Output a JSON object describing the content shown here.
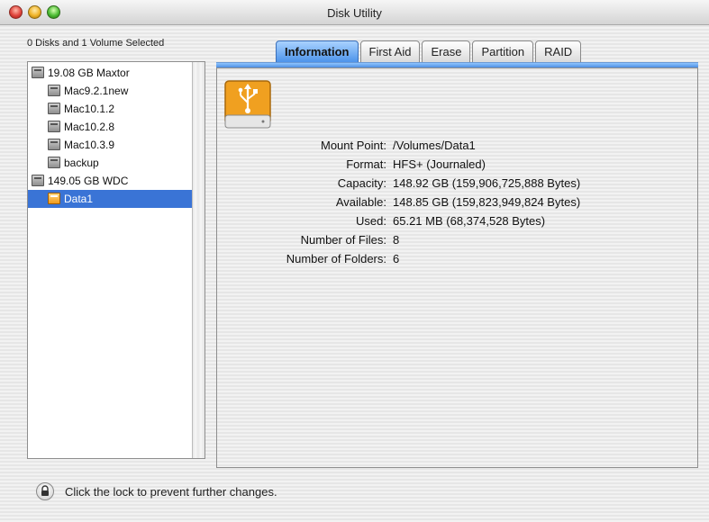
{
  "window": {
    "title": "Disk Utility"
  },
  "sidebar": {
    "selection_summary": "0 Disks and 1 Volume Selected",
    "items": [
      {
        "label": "19.08 GB Maxtor",
        "level": 0,
        "kind": "disk"
      },
      {
        "label": "Mac9.2.1new",
        "level": 1,
        "kind": "volume"
      },
      {
        "label": "Mac10.1.2",
        "level": 1,
        "kind": "volume"
      },
      {
        "label": "Mac10.2.8",
        "level": 1,
        "kind": "volume"
      },
      {
        "label": "Mac10.3.9",
        "level": 1,
        "kind": "volume"
      },
      {
        "label": "backup",
        "level": 1,
        "kind": "volume"
      },
      {
        "label": "149.05 GB WDC",
        "level": 0,
        "kind": "disk"
      },
      {
        "label": "Data1",
        "level": 1,
        "kind": "usb-volume",
        "selected": true
      }
    ]
  },
  "tabs": [
    {
      "label": "Information",
      "active": true
    },
    {
      "label": "First Aid",
      "active": false
    },
    {
      "label": "Erase",
      "active": false
    },
    {
      "label": "Partition",
      "active": false
    },
    {
      "label": "RAID",
      "active": false
    }
  ],
  "info": {
    "icon": "usb-drive-icon",
    "rows": [
      {
        "label": "Mount Point:",
        "value": "/Volumes/Data1"
      },
      {
        "label": "Format:",
        "value": "HFS+ (Journaled)"
      },
      {
        "label": "Capacity:",
        "value": "148.92 GB (159,906,725,888 Bytes)"
      },
      {
        "label": "Available:",
        "value": "148.85 GB (159,823,949,824 Bytes)"
      },
      {
        "label": "Used:",
        "value": "65.21 MB (68,374,528 Bytes)"
      },
      {
        "label": "Number of Files:",
        "value": "8"
      },
      {
        "label": "Number of Folders:",
        "value": "6"
      }
    ]
  },
  "footer": {
    "lock_icon": "lock-icon",
    "lock_text": "Click the lock to prevent further changes."
  },
  "colors": {
    "selection": "#3a74d6",
    "active_tab": "#4d93ea",
    "usb_icon": "#f0a020"
  }
}
